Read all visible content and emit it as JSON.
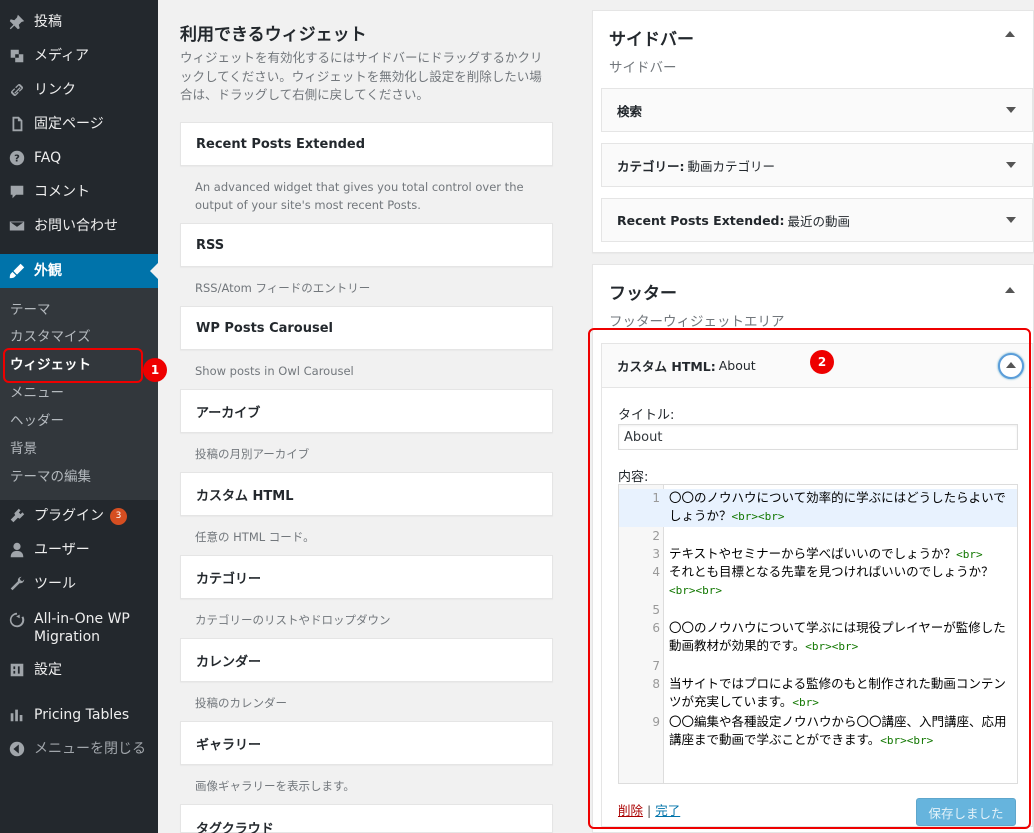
{
  "sidebar": {
    "items": [
      {
        "label": "投稿",
        "icon": "pin-icon"
      },
      {
        "label": "メディア",
        "icon": "media-icon"
      },
      {
        "label": "リンク",
        "icon": "link-icon"
      },
      {
        "label": "固定ページ",
        "icon": "page-icon"
      },
      {
        "label": "FAQ",
        "icon": "help-icon"
      },
      {
        "label": "コメント",
        "icon": "comment-icon"
      },
      {
        "label": "お問い合わせ",
        "icon": "mail-icon"
      },
      {
        "label": "外観",
        "icon": "brush-icon"
      }
    ],
    "submenu": [
      "テーマ",
      "カスタマイズ",
      "ウィジェット",
      "メニュー",
      "ヘッダー",
      "背景",
      "テーマの編集"
    ],
    "lower": [
      {
        "label": "プラグイン",
        "icon": "plugin-icon",
        "badge": "3"
      },
      {
        "label": "ユーザー",
        "icon": "user-icon"
      },
      {
        "label": "ツール",
        "icon": "tool-icon"
      },
      {
        "label": "All-in-One WP Migration",
        "icon": "migration-icon"
      },
      {
        "label": "設定",
        "icon": "settings-icon"
      },
      {
        "label": "Pricing Tables",
        "icon": "table-icon"
      },
      {
        "label": "メニューを閉じる",
        "icon": "collapse-icon"
      }
    ]
  },
  "available": {
    "heading": "利用できるウィジェット",
    "description": "ウィジェットを有効化するにはサイドバーにドラッグするかクリックしてください。ウィジェットを無効化し設定を削除したい場合は、ドラッグして右側に戻してください。",
    "widgets": [
      {
        "name": "Recent Posts Extended",
        "desc": "An advanced widget that gives you total control over the output of your site's most recent Posts."
      },
      {
        "name": "RSS",
        "desc": "RSS/Atom フィードのエントリー"
      },
      {
        "name": "WP Posts Carousel",
        "desc": "Show posts in Owl Carousel"
      },
      {
        "name": "アーカイブ",
        "desc": "投稿の月別アーカイブ"
      },
      {
        "name": "カスタム HTML",
        "desc": "任意の HTML コード。"
      },
      {
        "name": "カテゴリー",
        "desc": "カテゴリーのリストやドロップダウン"
      },
      {
        "name": "カレンダー",
        "desc": "投稿のカレンダー"
      },
      {
        "name": "ギャラリー",
        "desc": "画像ギャラリーを表示します。"
      },
      {
        "name": "タグクラウド",
        "desc": ""
      }
    ]
  },
  "sidebar_area": {
    "title": "サイドバー",
    "subtitle": "サイドバー",
    "widgets": [
      {
        "name": "検索",
        "note": ""
      },
      {
        "name": "カテゴリー:",
        "note": "動画カテゴリー"
      },
      {
        "name": "Recent Posts Extended:",
        "note": "最近の動画"
      }
    ]
  },
  "footer_area": {
    "title": "フッター",
    "subtitle": "フッターウィジェットエリア",
    "widget": {
      "name": "カスタム HTML:",
      "note": "About",
      "title_label": "タイトル:",
      "title_value": "About",
      "content_label": "内容:",
      "lines": [
        {
          "n": "1",
          "text": "〇〇のノウハウについて効率的に学ぶにはどうしたらよいでしょうか？",
          "tag": "<br><br>"
        },
        {
          "n": "2",
          "text": "",
          "tag": ""
        },
        {
          "n": "3",
          "text": "テキストやセミナーから学べばいいのでしょうか？",
          "tag": "<br>"
        },
        {
          "n": "4",
          "text": "それとも目標となる先輩を見つければいいのでしょうか？",
          "tag": "<br><br>"
        },
        {
          "n": "5",
          "text": "",
          "tag": ""
        },
        {
          "n": "6",
          "text": "〇〇のノウハウについて学ぶには現役プレイヤーが監修した動画教材が効果的です。",
          "tag": "<br><br>"
        },
        {
          "n": "7",
          "text": "",
          "tag": ""
        },
        {
          "n": "8",
          "text": "当サイトではプロによる監修のもと制作された動画コンテンツが充実しています。",
          "tag": "<br>"
        },
        {
          "n": "9",
          "text": "〇〇編集や各種設定ノウハウから〇〇講座、入門講座、応用講座まで動画で学ぶことができます。",
          "tag": "<br><br>"
        }
      ],
      "delete_label": "削除",
      "separator": "|",
      "done_label": "完了",
      "save_label": "保存しました"
    }
  },
  "annotations": {
    "one": "1",
    "two": "2"
  },
  "colors": {
    "menu_bg": "#23282d",
    "active": "#0073aa",
    "accent_red": "#e00000"
  }
}
